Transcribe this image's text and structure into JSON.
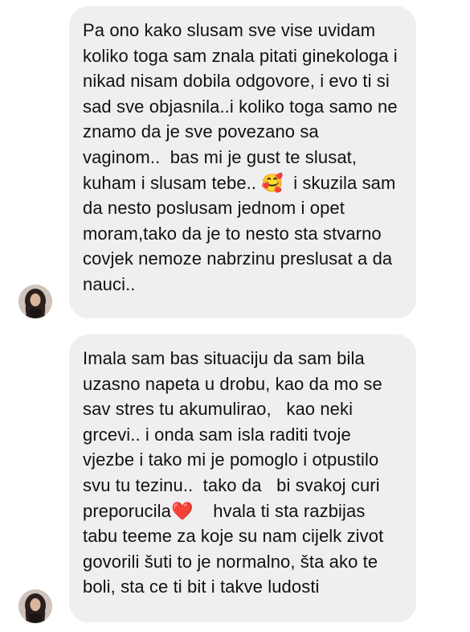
{
  "messages": [
    {
      "sender": "other",
      "text": "Pa ono kako slusam sve vise uvidam koliko toga sam znala pitati ginekologa i nikad nisam dobila odgovore, i evo ti si  sad sve objasnila..i koliko toga samo ne znamo da je sve povezano sa vaginom..  bas mi je gust te slusat, kuham i slusam tebe.. 🥰  i skuzila sam da nesto poslusam jednom i opet moram,tako da je to nesto sta stvarno covjek nemoze nabrzinu preslusat a da nauci.."
    },
    {
      "sender": "other",
      "text": "Imala sam bas situaciju da sam bila uzasno napeta u drobu, kao da mo se sav stres tu akumulirao,   kao neki grcevi.. i onda sam isla raditi tvoje vjezbe i tako mi je pomoglo i otpustilo  svu tu tezinu..  tako da   bi svakoj curi preporucila❤️    hvala ti sta razbijas tabu teeme za koje su nam cijelk zivot govorili šuti to je normalno, šta ako te boli, sta ce ti bit i takve ludosti"
    }
  ]
}
